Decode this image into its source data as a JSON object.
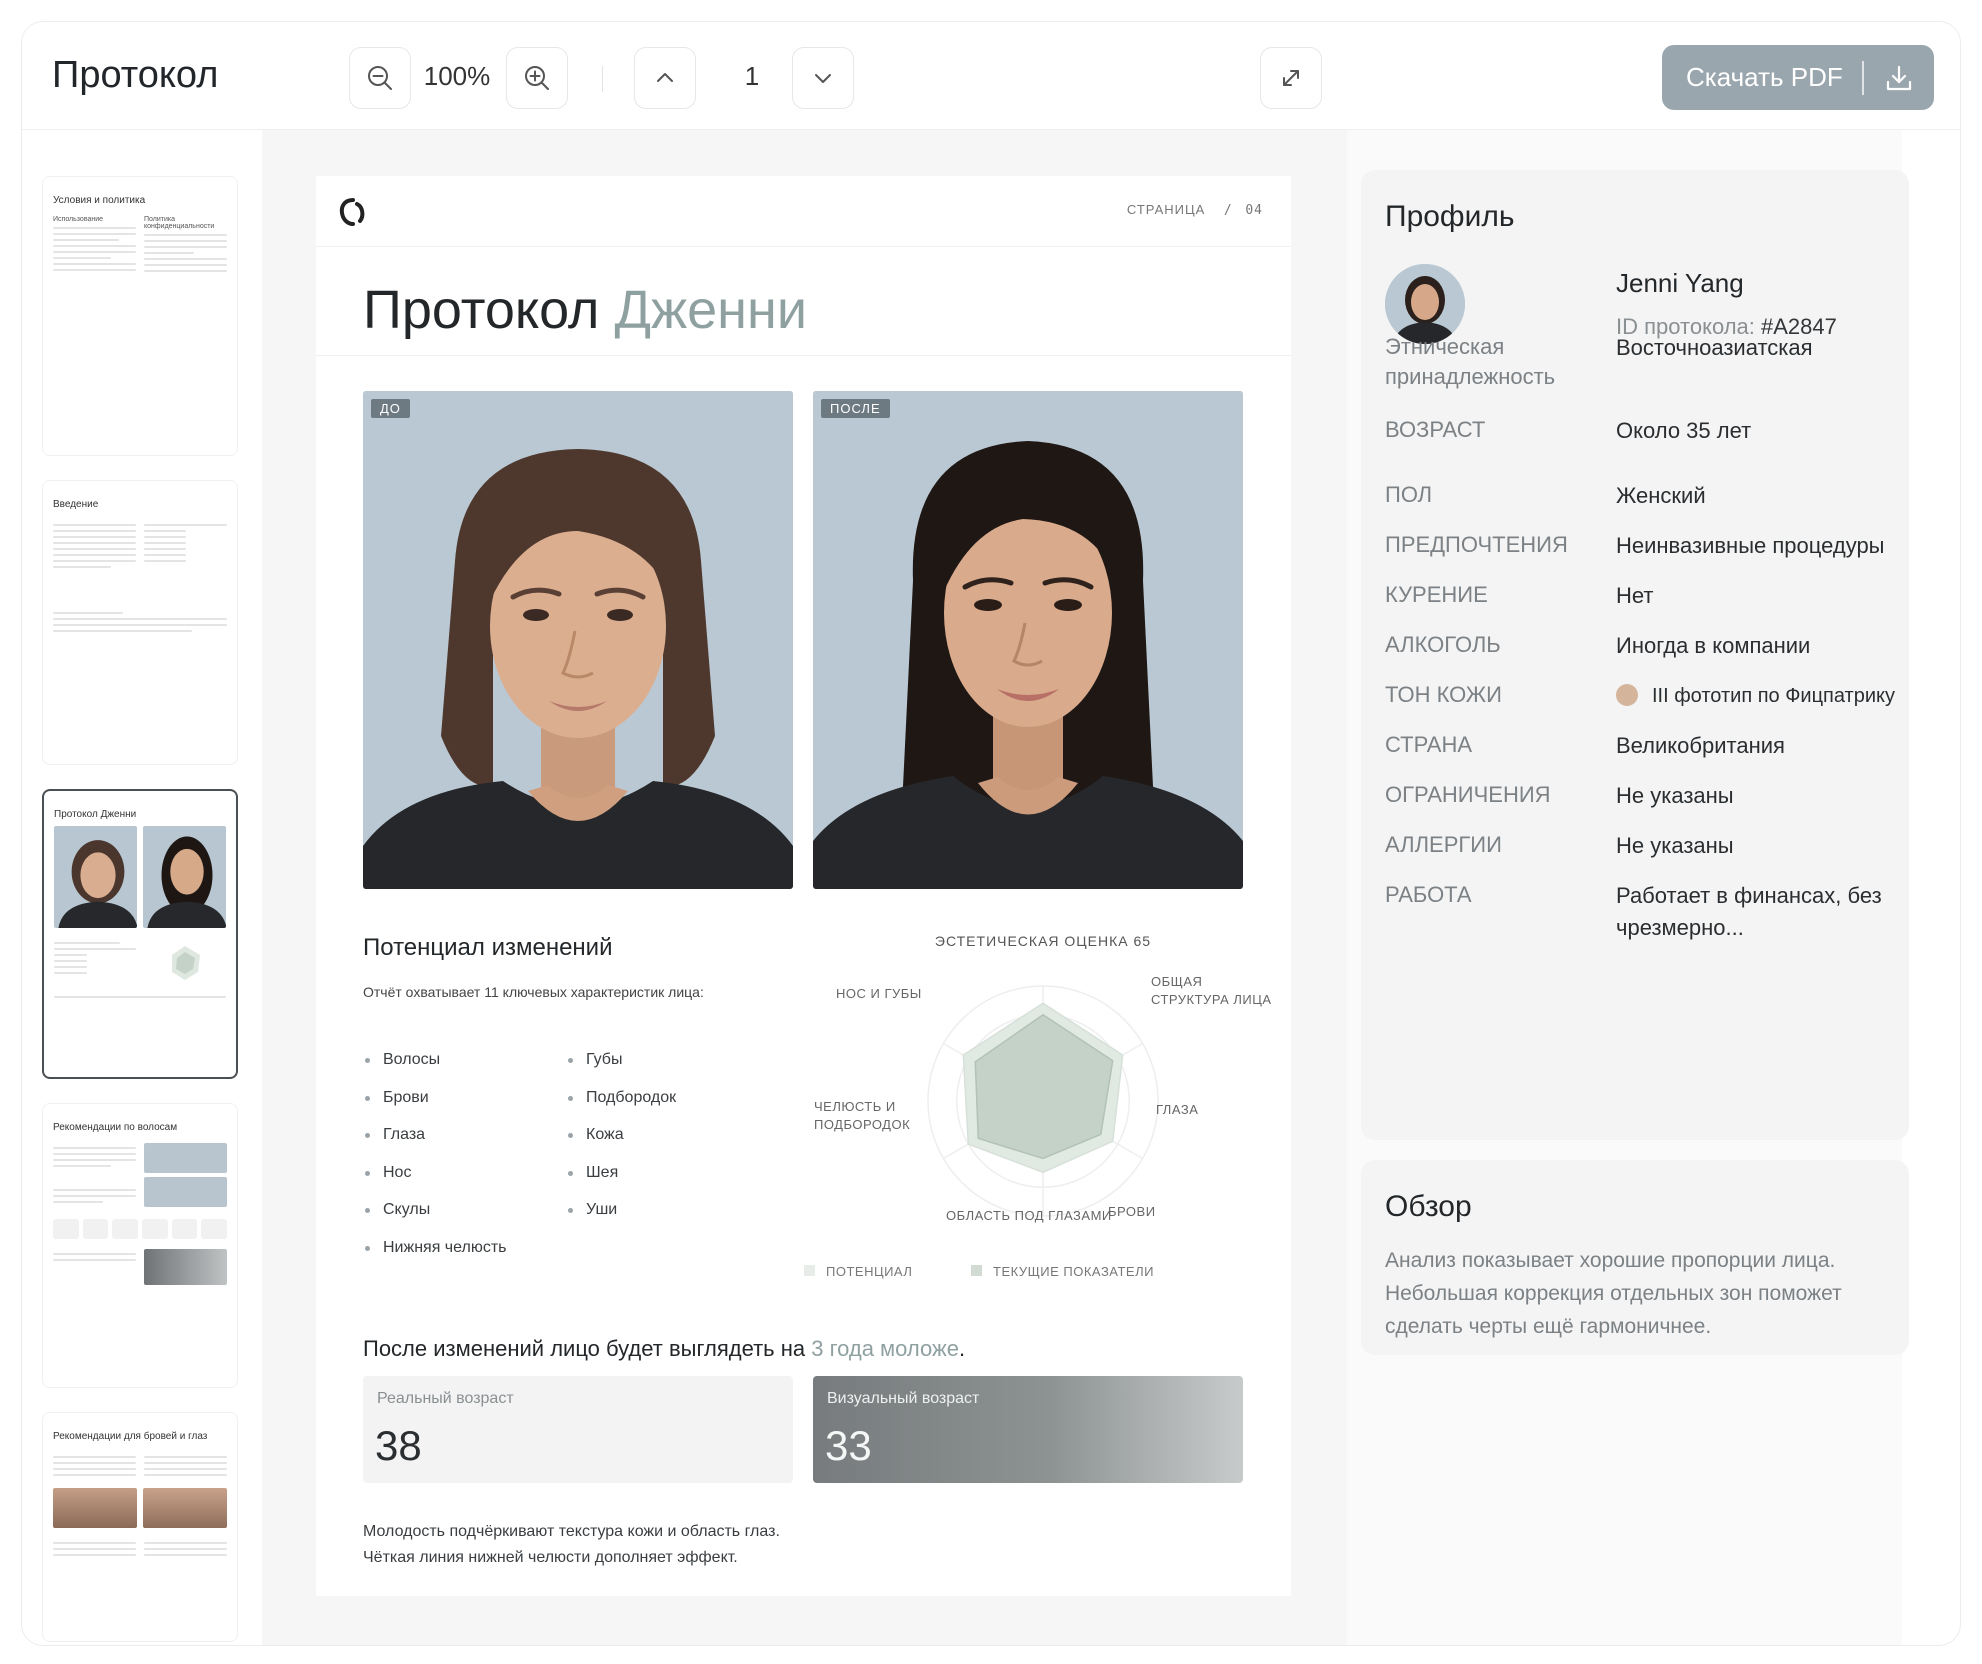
{
  "toolbar": {
    "title": "Протокол",
    "zoom": "100%",
    "page": "1",
    "download_label": "Скачать PDF"
  },
  "thumbnails": [
    {
      "title": "Условия и политика",
      "col1": "Использование",
      "col2": "Политика конфиденциальности"
    },
    {
      "title": "Введение"
    },
    {
      "title": "Протокол Дженни"
    },
    {
      "title": "Рекомендации по волосам"
    },
    {
      "title": "Рекомендации для бровей и глаз"
    }
  ],
  "document": {
    "page_label": "СТРАНИЦА",
    "page_sep": "/",
    "page_number": "04",
    "heading_main": "Протокол",
    "heading_accent": "Дженни",
    "before_tag": "ДО",
    "after_tag": "ПОСЛЕ",
    "potential_title": "Потенциал изменений",
    "potential_desc": "Отчёт охватывает 11 ключевых характеристик лица:",
    "features_left": [
      "Волосы",
      "Брови",
      "Глаза",
      "Нос",
      "Скулы",
      "Нижняя челюсть"
    ],
    "features_right": [
      "Губы",
      "Подбородок",
      "Кожа",
      "Шея",
      "Уши"
    ],
    "young_prefix": "После изменений лицо будет выглядеть на",
    "young_accent": "3 года моложе",
    "young_suffix": ".",
    "real_age_label": "Реальный возраст",
    "real_age": "38",
    "visual_age_label": "Визуальный возраст",
    "visual_age": "33",
    "note_line1": "Молодость подчёркивают текстура кожи и область глаз.",
    "note_line2": "Чёткая линия нижней челюсти дополняет эффект."
  },
  "chart_data": {
    "type": "radar",
    "title": "ЭСТЕТИЧЕСКАЯ ОЦЕНКА 65",
    "axes": [
      "ОБЩАЯ СТРУКТУРА ЛИЦА",
      "ГЛАЗА",
      "БРОВИ",
      "ОБЛАСТЬ ПОД ГЛАЗАМИ",
      "ЧЕЛЮСТЬ И ПОДБОРОДОК",
      "НОС И ГУБЫ"
    ],
    "axis_lines": [
      [
        "ОБЩАЯ",
        "СТРУКТУРА ЛИЦА"
      ],
      [
        "ГЛАЗА"
      ],
      [
        "БРОВИ"
      ],
      [
        "ОБЛАСТЬ ПОД ГЛАЗАМИ"
      ],
      [
        "ЧЕЛЮСТЬ И",
        "ПОДБОРОДОК"
      ],
      [
        "НОС И ГУБЫ"
      ]
    ],
    "range": [
      0,
      100
    ],
    "series": [
      {
        "name": "ПОТЕНЦИАЛ",
        "values": [
          85,
          80,
          70,
          62,
          75,
          80
        ],
        "color": "#e1e9e3"
      },
      {
        "name": "ТЕКУЩИЕ ПОКАЗАТЕЛИ",
        "values": [
          75,
          70,
          58,
          50,
          65,
          68
        ],
        "color": "#c4d2c8"
      }
    ]
  },
  "profile": {
    "title": "Профиль",
    "name": "Jenni Yang",
    "id_label": "ID протокола:",
    "id_value": "#A2847",
    "rows": [
      {
        "key": "Этническая принадлежность",
        "value": "Восточноазиатская"
      },
      {
        "key": "ВОЗРАСТ",
        "value": "Около 35 лет"
      },
      {
        "key": "ПОЛ",
        "value": "Женский"
      },
      {
        "key": "ПРЕДПОЧТЕНИЯ",
        "value": "Неинвазивные процедуры"
      },
      {
        "key": "КУРЕНИЕ",
        "value": "Нет"
      },
      {
        "key": "АЛКОГОЛЬ",
        "value": "Иногда в компании"
      },
      {
        "key": "ТОН КОЖИ",
        "value": "III фототип по Фицпатрику"
      },
      {
        "key": "СТРАНА",
        "value": "Великобритания"
      },
      {
        "key": "ОГРАНИЧЕНИЯ",
        "value": "Не указаны"
      },
      {
        "key": "АЛЛЕРГИИ",
        "value": "Не указаны"
      },
      {
        "key": "РАБОТА",
        "value": "Работает в финансах, без чрезмерно..."
      }
    ]
  },
  "overview": {
    "title": "Обзор",
    "text": "Анализ показывает хорошие пропорции лица. Небольшая коррекция отдельных зон поможет сделать черты ещё гармоничнее."
  }
}
